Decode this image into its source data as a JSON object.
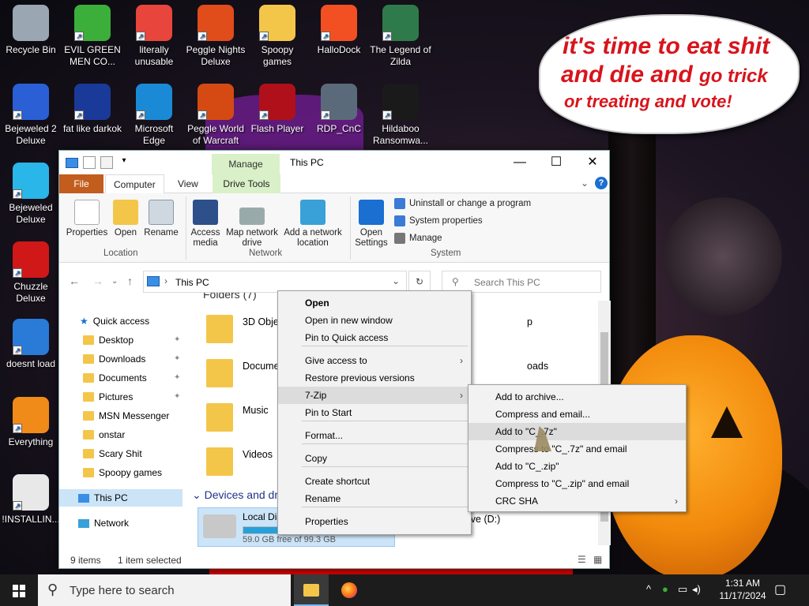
{
  "desktop": {
    "icons": [
      {
        "label": "Recycle Bin",
        "icon": "recycle-bin-icon",
        "color": "#9aa6b2"
      },
      {
        "label": "EVIL GREEN MEN CO...",
        "icon": "msn-people-icon",
        "color": "#3cae3a"
      },
      {
        "label": "literally unusable",
        "icon": "chrome-icon",
        "color": "#e8453c"
      },
      {
        "label": "Peggle Nights Deluxe",
        "icon": "peggle-icon",
        "color": "#e04c1a"
      },
      {
        "label": "Spoopy games",
        "icon": "folder-icon",
        "color": "#f3c64a"
      },
      {
        "label": "HalloDock",
        "icon": "windows-logo-icon",
        "color": "#f25022"
      },
      {
        "label": "The Legend of Zilda",
        "icon": "zilda-game-icon",
        "color": "#2f7a4a"
      },
      {
        "label": "Bejeweled 2 Deluxe",
        "icon": "bejeweled-icon",
        "color": "#2a5fd6"
      },
      {
        "label": "fat like darkok",
        "icon": "mpl-logo-icon",
        "color": "#1a3a9a"
      },
      {
        "label": "Microsoft Edge",
        "icon": "edge-icon",
        "color": "#1b8ad6"
      },
      {
        "label": "Peggle World of Warcraft",
        "icon": "peggle-wow-icon",
        "color": "#d44a12"
      },
      {
        "label": "Flash Player",
        "icon": "flash-icon",
        "color": "#b0101a"
      },
      {
        "label": "RDP_CnC",
        "icon": "rdp-icon",
        "color": "#5a6a7a"
      },
      {
        "label": "Hildaboo Ransomwa...",
        "icon": "yashma-icon",
        "color": "#1a1a1a"
      },
      {
        "label": "Bejeweled Deluxe",
        "icon": "gem-icon",
        "color": "#2ab6e8"
      },
      {
        "label": "Chuzzle Deluxe",
        "icon": "chuzzle-icon",
        "color": "#d01818"
      },
      {
        "label": "doesnt load",
        "icon": "thunderbird-icon",
        "color": "#2a7ad8"
      },
      {
        "label": "Everything",
        "icon": "everything-search-icon",
        "color": "#f08a18"
      },
      {
        "label": "!INSTALLIN...",
        "icon": "text-file-icon",
        "color": "#e8e8e8"
      }
    ],
    "bubble": {
      "line1": "it's time to eat shit",
      "line2a": "and die and ",
      "line2b": "go trick",
      "line3": "or treating and vote!"
    }
  },
  "explorer": {
    "title": "This PC",
    "manage_tab": "Manage",
    "tabs": {
      "file": "File",
      "computer": "Computer",
      "view": "View",
      "drive_tools": "Drive Tools"
    },
    "ribbon": {
      "properties": "Properties",
      "open": "Open",
      "rename": "Rename",
      "location_group": "Location",
      "access_media": "Access media",
      "map_network_drive": "Map network drive",
      "add_network_location": "Add a network location",
      "network_group": "Network",
      "open_settings": "Open Settings",
      "uninstall": "Uninstall or change a program",
      "system_properties": "System properties",
      "manage": "Manage",
      "system_group": "System"
    },
    "address": {
      "path": "This PC",
      "search_placeholder": "Search This PC"
    },
    "sidebar": {
      "quick_access": "Quick access",
      "items": [
        "Desktop",
        "Downloads",
        "Documents",
        "Pictures",
        "MSN Messenger",
        "onstar",
        "Scary Shit",
        "Spoopy games"
      ],
      "this_pc": "This PC",
      "network": "Network"
    },
    "content": {
      "folders_header": "Folders (7)",
      "folders": [
        "3D Objects",
        "Documents",
        "Music",
        "Videos"
      ],
      "right_frag": [
        "p",
        "oads"
      ],
      "devices_header": "Devices and drives (2)",
      "drive_name": "Local Disk (C:)",
      "drive_free": "59.0 GB free of 99.3 GB",
      "drive_fill": 0.406,
      "drive_d": "ive (D:)"
    },
    "status": {
      "items": "9 items",
      "selected": "1 item selected"
    }
  },
  "context_menu": {
    "items": [
      "Open",
      "Open in new window",
      "Pin to Quick access",
      "Give access to",
      "Restore previous versions",
      "7-Zip",
      "Pin to Start",
      "Format...",
      "Copy",
      "Create shortcut",
      "Rename",
      "Properties"
    ]
  },
  "submenu": {
    "items": [
      "Add to archive...",
      "Compress and email...",
      "Add to \"C_.7z\"",
      "Compress to \"C_.7z\" and email",
      "Add to \"C_.zip\"",
      "Compress to \"C_.zip\" and email",
      "CRC SHA"
    ]
  },
  "taskbar": {
    "search_placeholder": "Type here to search",
    "time": "1:31 AM",
    "date": "11/17/2024"
  }
}
